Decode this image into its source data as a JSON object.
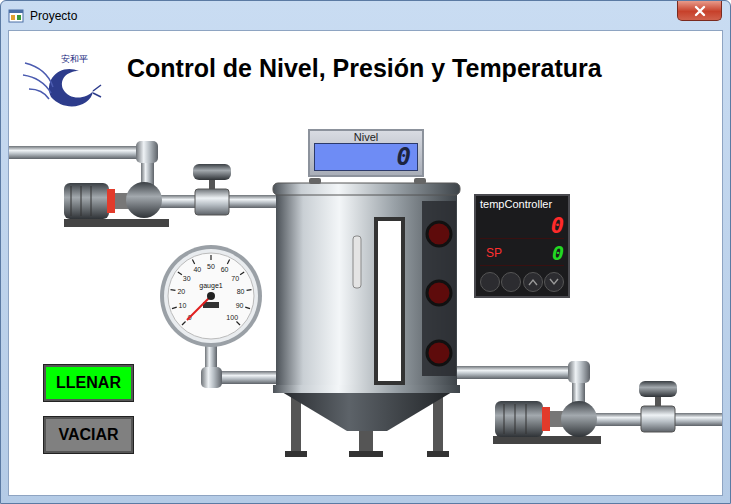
{
  "window": {
    "title": "Proyecto"
  },
  "header": {
    "logo_text": "安和平",
    "title": "Control de Nivel, Presión y Temperatura"
  },
  "level_display": {
    "label": "Nivel",
    "value": "0"
  },
  "tank": {
    "level": 0,
    "lights": [
      {
        "on": false
      },
      {
        "on": false
      },
      {
        "on": false
      }
    ]
  },
  "gauge": {
    "label": "gauge1",
    "level": 0,
    "ticks": [
      "0",
      "10",
      "20",
      "30",
      "40",
      "50",
      "60",
      "70",
      "80",
      "90",
      "100"
    ]
  },
  "temp_controller": {
    "label": "tempController",
    "pv": "0",
    "sp_label": "SP",
    "sp": "0"
  },
  "buttons": [
    {
      "label": "LLENAR",
      "color": "#00ff00"
    },
    {
      "label": "VACIAR",
      "color": "#808080"
    }
  ]
}
